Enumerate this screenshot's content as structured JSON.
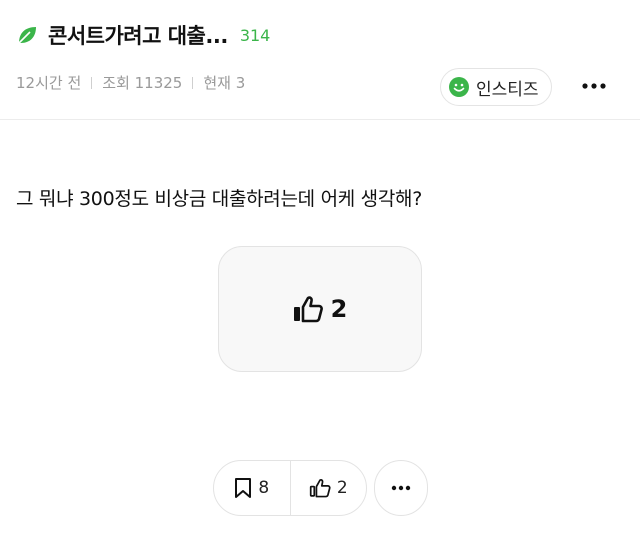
{
  "post": {
    "title": "콘서트가려고 대출...",
    "comment_count": "314",
    "meta": {
      "time": "12시간 전",
      "views": "조회 11325",
      "now": "현재 3"
    },
    "board": {
      "name": "인스티즈",
      "icon": "smile-icon"
    },
    "body": "그 뭐냐 300정도 비상금 대출하려는데 어케 생각해?",
    "like_box_count": "2"
  },
  "actions": {
    "bookmark_count": "8",
    "like_count": "2"
  },
  "icons": {
    "title_icon": "leaf-icon",
    "more": "more-dots-icon",
    "bookmark": "bookmark-icon",
    "like": "thumbs-up-icon"
  },
  "colors": {
    "accent_green": "#3bb54a",
    "meta_gray": "#9a9a9a",
    "border": "#e3e3e3"
  }
}
